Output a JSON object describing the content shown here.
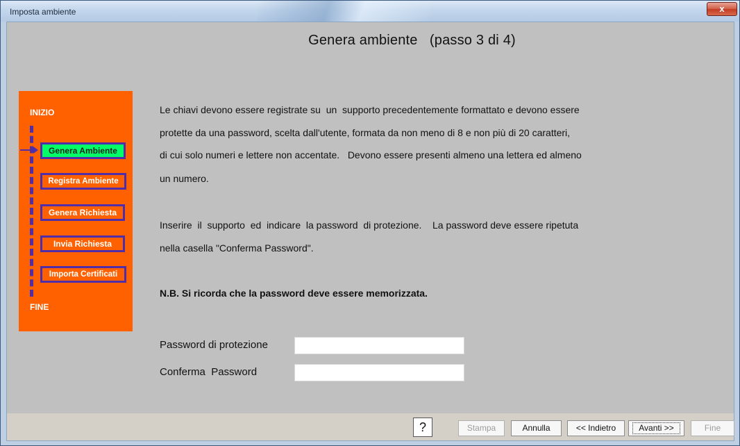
{
  "window": {
    "title": "Imposta ambiente",
    "close_glyph": "x"
  },
  "heading": "Genera ambiente   (passo 3 di 4)",
  "steps": {
    "start_label": "INIZIO",
    "end_label": "FINE",
    "items": [
      {
        "label": "Genera Ambiente",
        "active": true
      },
      {
        "label": "Registra Ambiente",
        "active": false
      },
      {
        "label": "Genera Richiesta",
        "active": false
      },
      {
        "label": "Invia Richiesta",
        "active": false
      },
      {
        "label": "Importa Certificati",
        "active": false
      }
    ],
    "colors": {
      "panel": "#ff6100",
      "active": "#00ff66",
      "border": "#4f2ea8"
    }
  },
  "instructions": {
    "lines": [
      "Le chiavi devono essere registrate su  un  supporto precedentemente formattato e devono essere",
      "protette da una password, scelta dall'utente, formata da non meno di 8 e non più di 20 caratteri,",
      "di cui solo numeri e lettere non accentate.   Devono essere presenti almeno una lettera ed almeno",
      "un numero.",
      "Inserire  il  supporto  ed  indicare  la password  di protezione.    La password deve essere ripetuta",
      "nella casella \"Conferma Password\"."
    ],
    "note": "N.B. Si ricorda che la password deve essere memorizzata."
  },
  "form": {
    "password_label": "Password di protezione",
    "password_value": "",
    "confirm_label": "Conferma  Password",
    "confirm_value": ""
  },
  "footer": {
    "help": "?",
    "print": "Stampa",
    "cancel": "Annulla",
    "back": "<< Indietro",
    "next": "Avanti >>",
    "finish": "Fine"
  }
}
